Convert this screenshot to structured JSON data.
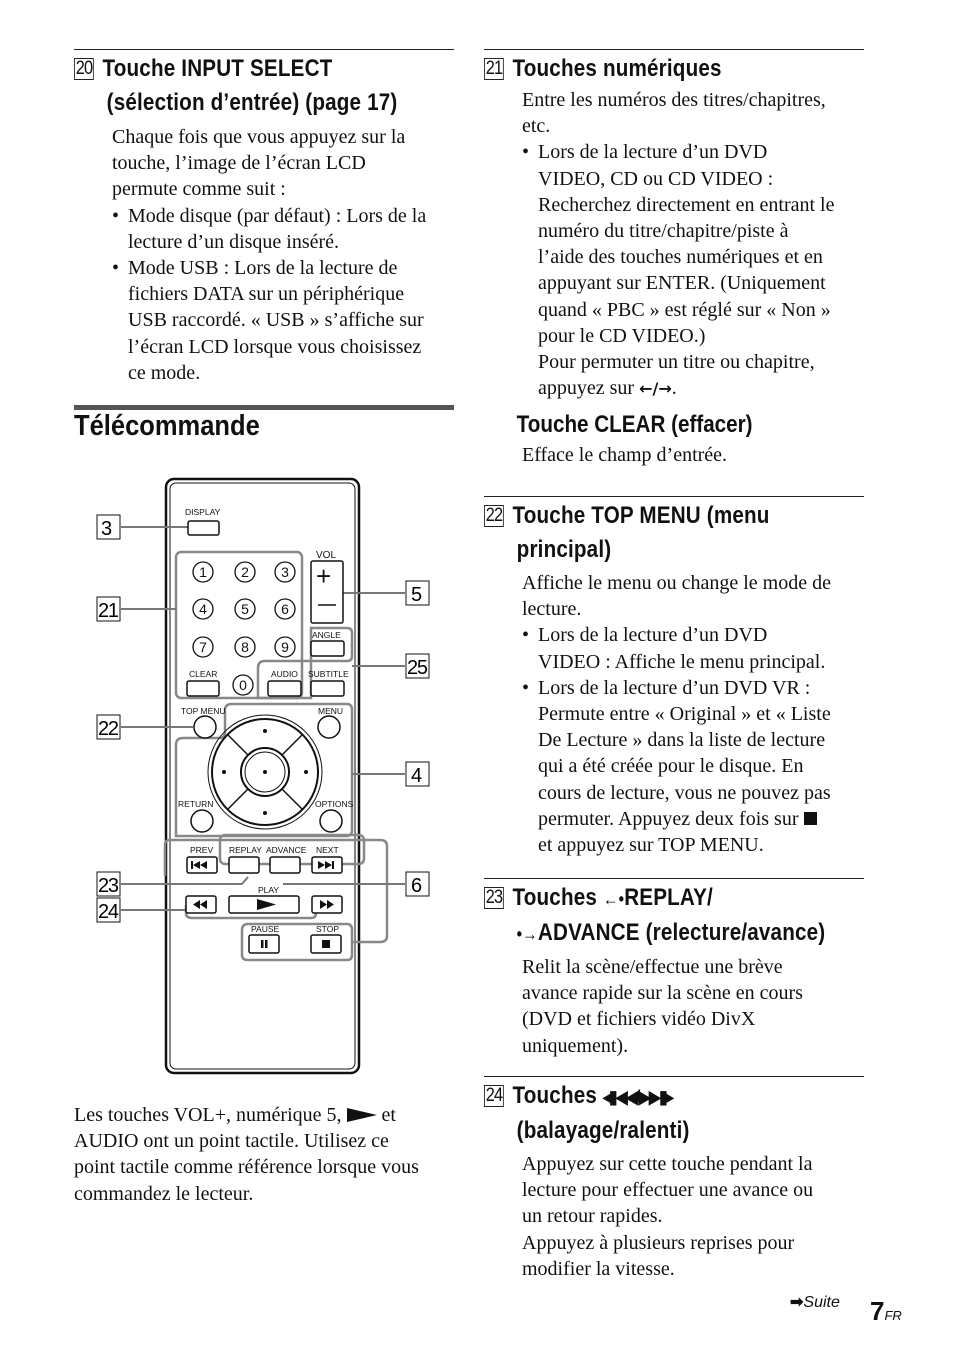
{
  "left": {
    "s20": {
      "number": "20",
      "title_line1": "Touche INPUT SELECT",
      "title_line2": "(sélection d’entrée) (page 17)",
      "intro": [
        "Chaque fois que vous appuyez sur la",
        "touche, l’image de l’écran LCD",
        "permute comme suit :"
      ],
      "bullets": [
        [
          "Mode disque (par défaut) : Lors de la",
          "lecture d’un disque inséré."
        ],
        [
          "Mode USB : Lors de la lecture de",
          "fichiers DATA sur un périphérique",
          "USB raccordé. « USB » s’affiche sur",
          "l’écran LCD lorsque vous choisissez",
          "ce mode."
        ]
      ]
    },
    "section_title": "Télécommande",
    "remote": {
      "callouts": [
        "3",
        "21",
        "22",
        "23",
        "24",
        "5",
        "25",
        "4",
        "6"
      ],
      "buttons": {
        "display": "DISPLAY",
        "vol": "VOL",
        "angle": "ANGLE",
        "clear": "CLEAR",
        "audio": "AUDIO",
        "subtitle": "SUBTITLE",
        "top_menu": "TOP MENU",
        "menu": "MENU",
        "return": "RETURN",
        "options": "OPTIONS",
        "prev": "PREV",
        "replay": "REPLAY",
        "advance": "ADVANCE",
        "next": "NEXT",
        "play": "PLAY",
        "pause": "PAUSE",
        "stop": "STOP",
        "digits": [
          "1",
          "2",
          "3",
          "4",
          "5",
          "6",
          "7",
          "8",
          "9",
          "0"
        ]
      }
    },
    "note": [
      "Les touches VOL+, numérique 5, ",
      " et",
      "AUDIO ont un point tactile. Utilisez ce",
      "point tactile comme référence lorsque vous",
      "commandez le lecteur."
    ]
  },
  "right": {
    "s21": {
      "number": "21",
      "title": "Touches numériques",
      "intro": [
        "Entre les numéros des titres/chapitres,",
        "etc."
      ],
      "bullet": [
        "Lors de la lecture d’un DVD",
        "VIDEO, CD ou CD VIDEO :",
        "Recherchez directement en entrant le",
        "numéro du titre/chapitre/piste à",
        "l’aide des touches numériques et en",
        "appuyant sur ENTER. (Uniquement",
        "quand « PBC » est réglé sur « Non »",
        "pour le CD VIDEO.)",
        "Pour permuter un titre ou chapitre,",
        "appuyez sur "
      ],
      "arrows": "←/→",
      "clear_title": "Touche CLEAR (effacer)",
      "clear_text": "Efface le champ d’entrée."
    },
    "s22": {
      "number": "22",
      "title_line1": "Touche TOP MENU (menu",
      "title_line2": "principal)",
      "intro": [
        "Affiche le menu ou change le mode de",
        "lecture."
      ],
      "bullets": [
        [
          "Lors de la lecture d’un DVD",
          "VIDEO : Affiche le menu principal."
        ],
        [
          "Lors de la lecture d’un DVD VR :",
          "Permute entre « Original » et « Liste",
          "De Lecture » dans la liste de lecture",
          "qui a été créée pour le disque. En",
          "cours de lecture, vous ne pouvez pas",
          "permuter. Appuyez deux fois sur ",
          "et appuyez sur TOP MENU."
        ]
      ]
    },
    "s23": {
      "number": "23",
      "title_line1": "Touches ",
      "title_replay": "REPLAY/",
      "title_line2": "ADVANCE (relecture/avance)",
      "text": [
        "Relit la scène/effectue une brève",
        "avance rapide sur la scène en cours",
        "(DVD et fichiers vidéo DivX",
        "uniquement)."
      ]
    },
    "s24": {
      "number": "24",
      "title_line1": "Touches ",
      "title_line2": "(balayage/ralenti)",
      "text": [
        "Appuyez sur cette touche pendant la",
        "lecture pour effectuer une avance ou",
        "un retour rapides.",
        "Appuyez à plusieurs reprises pour",
        "modifier la vitesse."
      ]
    }
  },
  "footer": {
    "continue": "Suite",
    "page": "7",
    "lang": "FR"
  }
}
